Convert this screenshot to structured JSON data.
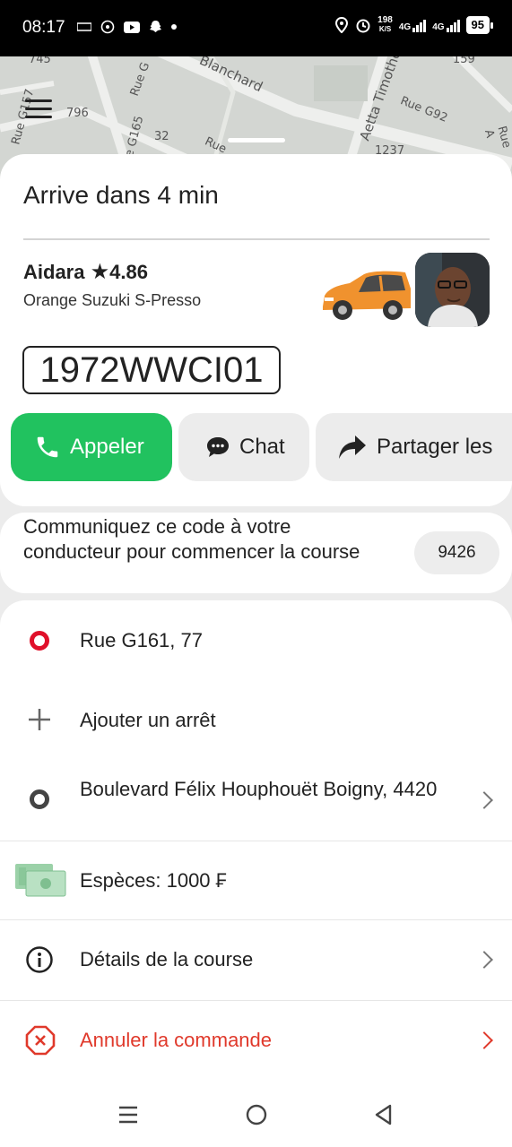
{
  "status_bar": {
    "time": "08:17",
    "net_speed_top": "198",
    "net_speed_bottom": "K/S",
    "sim1": "4G",
    "sim2": "4G",
    "battery": "95"
  },
  "map": {
    "labels": [
      "Rue G",
      "Blanchard",
      "Rue G92",
      "796",
      "32",
      "Rue",
      "1237",
      "Rue G157",
      "Rue G165",
      "745",
      "159",
      "Aetta Timothée",
      "Rue A"
    ]
  },
  "ride": {
    "title": "Arrive dans 4 min",
    "driver_name": "Aidara",
    "rating": "4.86",
    "car": "Orange Suzuki S-Presso",
    "plate": "1972WWCI01",
    "car_color": "#f0922e"
  },
  "actions": {
    "call": "Appeler",
    "chat": "Chat",
    "share": "Partager les"
  },
  "code": {
    "message": "Communiquez ce code à votre conducteur pour commencer la course",
    "value": "9426"
  },
  "route": {
    "pickup": "Rue G161, 77",
    "add_stop": "Ajouter un arrêt",
    "destination": "Boulevard Félix Houphouët Boigny, 4420",
    "payment": "Espèces: 1000 ₣",
    "details": "Détails de la course",
    "cancel": "Annuler la commande"
  },
  "colors": {
    "accent_green": "#21c25f",
    "danger_red": "#e0392b",
    "pickup_red": "#e0102a"
  },
  "icons": [
    "phone-icon",
    "chat-icon",
    "share-icon",
    "pickup-dot-icon",
    "plus-icon",
    "destination-dot-icon",
    "cash-icon",
    "info-icon",
    "cancel-icon",
    "chevron-right-icon",
    "menu-icon",
    "star-icon"
  ]
}
